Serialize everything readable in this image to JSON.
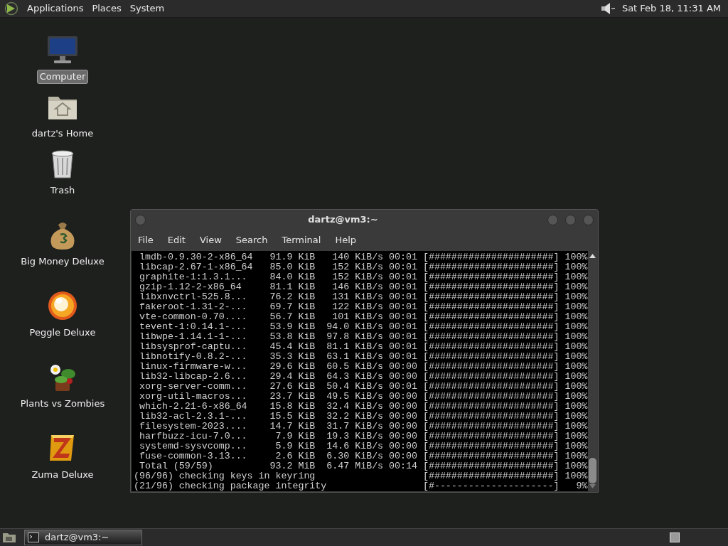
{
  "top_panel": {
    "menus": [
      "Applications",
      "Places",
      "System"
    ],
    "clock": "Sat Feb 18, 11:31 AM"
  },
  "desktop_icons": [
    {
      "kind": "computer",
      "label": "Computer",
      "selected": true
    },
    {
      "kind": "home",
      "label": "dartz's Home",
      "selected": false
    },
    {
      "kind": "trash",
      "label": "Trash",
      "selected": false
    },
    {
      "kind": "moneybag",
      "label": "Big Money Deluxe",
      "selected": false
    },
    {
      "kind": "ball",
      "label": "Peggle Deluxe",
      "selected": false
    },
    {
      "kind": "plant",
      "label": "Plants vs Zombies",
      "selected": false
    },
    {
      "kind": "block",
      "label": "Zuma Deluxe",
      "selected": false
    }
  ],
  "terminal": {
    "title": "dartz@vm3:~",
    "menu": [
      "File",
      "Edit",
      "View",
      "Search",
      "Terminal",
      "Help"
    ],
    "lines": [
      " lmdb-0.9.30-2-x86_64   91.9 KiB   140 KiB/s 00:01 [######################] 100%",
      " libcap-2.67-1-x86_64   85.0 KiB   152 KiB/s 00:01 [######################] 100%",
      " graphite-1:1.3.1...    84.0 KiB   152 KiB/s 00:01 [######################] 100%",
      " gzip-1.12-2-x86_64     81.1 KiB   146 KiB/s 00:01 [######################] 100%",
      " libxnvctrl-525.8...    76.2 KiB   131 KiB/s 00:01 [######################] 100%",
      " fakeroot-1.31-2-...    69.7 KiB   122 KiB/s 00:01 [######################] 100%",
      " vte-common-0.70....    56.7 KiB   101 KiB/s 00:01 [######################] 100%",
      " tevent-1:0.14.1-...    53.9 KiB  94.0 KiB/s 00:01 [######################] 100%",
      " libwpe-1.14.1-1-...    53.8 KiB  97.8 KiB/s 00:01 [######################] 100%",
      " libsysprof-captu...    45.4 KiB  81.1 KiB/s 00:01 [######################] 100%",
      " libnotify-0.8.2-...    35.3 KiB  63.1 KiB/s 00:01 [######################] 100%",
      " linux-firmware-w...    29.6 KiB  60.5 KiB/s 00:00 [######################] 100%",
      " lib32-libcap-2.6...    29.4 KiB  64.3 KiB/s 00:00 [######################] 100%",
      " xorg-server-comm...    27.6 KiB  50.4 KiB/s 00:01 [######################] 100%",
      " xorg-util-macros...    23.7 KiB  49.5 KiB/s 00:00 [######################] 100%",
      " which-2.21-6-x86_64    15.8 KiB  32.4 KiB/s 00:00 [######################] 100%",
      " lib32-acl-2.3.1-...    15.5 KiB  32.2 KiB/s 00:00 [######################] 100%",
      " filesystem-2023....    14.7 KiB  31.7 KiB/s 00:00 [######################] 100%",
      " harfbuzz-icu-7.0...     7.9 KiB  19.3 KiB/s 00:00 [######################] 100%",
      " systemd-sysvcomp...     5.9 KiB  14.6 KiB/s 00:00 [######################] 100%",
      " fuse-common-3.13...     2.6 KiB  6.30 KiB/s 00:00 [######################] 100%",
      " Total (59/59)          93.2 MiB  6.47 MiB/s 00:14 [######################] 100%",
      "(96/96) checking keys in keyring                   [######################] 100%",
      "(21/96) checking package integrity                 [#---------------------]   9%"
    ]
  },
  "taskbar": {
    "tasks": [
      {
        "label": "dartz@vm3:~",
        "selected": true
      }
    ]
  }
}
